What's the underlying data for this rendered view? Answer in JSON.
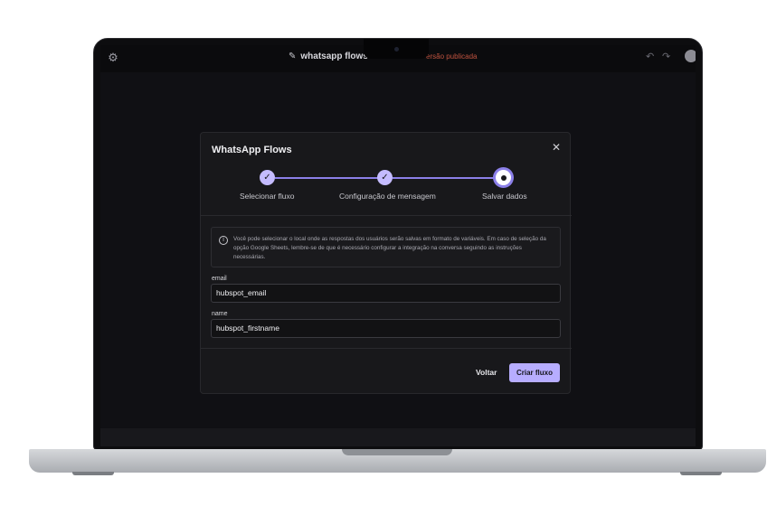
{
  "topbar": {
    "settings_icon": "gear-icon",
    "edit_icon": "pencil-icon",
    "flow_name": "whatsapp flows",
    "version_status": "ersão publicada",
    "undo_icon": "undo-icon",
    "redo_icon": "redo-icon"
  },
  "modal": {
    "title": "WhatsApp Flows",
    "close_icon": "close-icon",
    "steps": [
      {
        "label": "Selecionar fluxo",
        "state": "done"
      },
      {
        "label": "Configuração de mensagem",
        "state": "done"
      },
      {
        "label": "Salvar dados",
        "state": "current"
      }
    ],
    "info": {
      "icon": "info-icon",
      "text": "Você pode selecionar o local onde as respostas dos usuários serão salvas em formato de variáveis. Em caso de seleção da opção Google Sheets, lembre-se de que é necessário configurar a integração na conversa seguindo as instruções necessárias."
    },
    "fields": [
      {
        "label": "email",
        "value": "hubspot_email"
      },
      {
        "label": "name",
        "value": "hubspot_firstname"
      }
    ],
    "back_label": "Voltar",
    "create_label": "Criar fluxo"
  },
  "colors": {
    "accent": "#b7adff",
    "stepper_line": "#8b7fe8",
    "modal_bg": "#18181b",
    "screen_bg": "#101014",
    "version_text": "#c0533f"
  }
}
